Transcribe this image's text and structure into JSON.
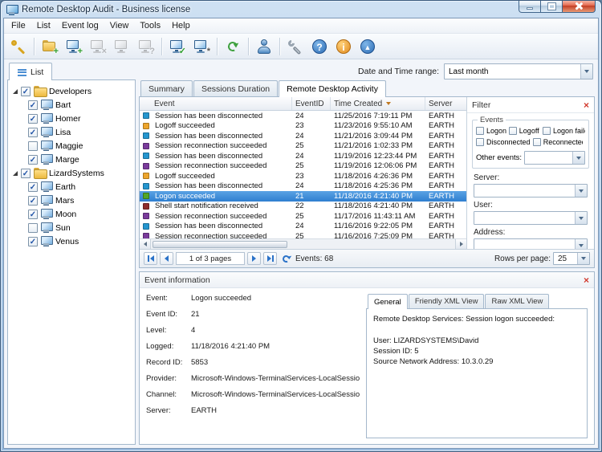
{
  "window": {
    "title": "Remote Desktop Audit - Business license"
  },
  "icons": {
    "check": "✓",
    "close": "×"
  },
  "colors": {
    "selection_blue": "#2f7fd0",
    "close_red": "#d23b2f",
    "accent_blue": "#2a72c8"
  },
  "menubar": {
    "items": [
      "File",
      "List",
      "Event log",
      "View",
      "Tools",
      "Help"
    ]
  },
  "toolbar": {
    "items": [
      {
        "icon": "key",
        "name": "license-key-button"
      },
      {
        "sep": true
      },
      {
        "icon": "folder-plus",
        "name": "add-group-button"
      },
      {
        "icon": "pc-plus",
        "name": "add-computer-button"
      },
      {
        "icon": "pc-delete",
        "name": "delete-computer-button",
        "disabled": true
      },
      {
        "icon": "pc-props",
        "name": "computer-properties-button",
        "disabled": true
      },
      {
        "icon": "pc-scan",
        "name": "scan-network-button",
        "disabled": true
      },
      {
        "sep": true
      },
      {
        "icon": "pc-check",
        "name": "collect-data-button"
      },
      {
        "icon": "pc-gear",
        "name": "collection-settings-button"
      },
      {
        "sep": true
      },
      {
        "icon": "refresh",
        "name": "refresh-button"
      },
      {
        "sep": true
      },
      {
        "icon": "user",
        "name": "user-sessions-button"
      },
      {
        "sep": true
      },
      {
        "icon": "wrench",
        "name": "options-button"
      },
      {
        "icon": "help",
        "name": "help-button"
      },
      {
        "icon": "about",
        "name": "about-button"
      },
      {
        "icon": "update",
        "name": "check-updates-button"
      }
    ]
  },
  "sidebar": {
    "tab_label": "List",
    "tree": [
      {
        "label": "Developers",
        "checked": true,
        "expanded": true,
        "children": [
          {
            "label": "Bart",
            "checked": true
          },
          {
            "label": "Homer",
            "checked": true
          },
          {
            "label": "Lisa",
            "checked": true
          },
          {
            "label": "Maggie",
            "checked": false
          },
          {
            "label": "Marge",
            "checked": true
          }
        ]
      },
      {
        "label": "LizardSystems",
        "checked": true,
        "expanded": true,
        "children": [
          {
            "label": "Earth",
            "checked": true
          },
          {
            "label": "Mars",
            "checked": true
          },
          {
            "label": "Moon",
            "checked": true
          },
          {
            "label": "Sun",
            "checked": false
          },
          {
            "label": "Venus",
            "checked": true
          }
        ]
      }
    ]
  },
  "main": {
    "date_range": {
      "label": "Date and Time range:",
      "value": "Last month"
    },
    "tabs": [
      {
        "label": "Summary"
      },
      {
        "label": "Sessions Duration"
      },
      {
        "label": "Remote Desktop Activity",
        "active": true
      }
    ]
  },
  "activity": {
    "columns": [
      {
        "label": "Event"
      },
      {
        "label": "EventID"
      },
      {
        "label": "Time Created",
        "sort": "desc"
      },
      {
        "label": "Server"
      }
    ],
    "type_colors": {
      "disconnected": "#2596cf",
      "logoff": "#eda52c",
      "reconnected": "#7a3b9b",
      "logon": "#53a626",
      "shell": "#8e2c2c"
    },
    "rows": [
      {
        "type": "disconnected",
        "event": "Session has been disconnected",
        "id": "24",
        "time": "11/25/2016 7:19:11 PM",
        "server": "EARTH"
      },
      {
        "type": "logoff",
        "event": "Logoff succeeded",
        "id": "23",
        "time": "11/23/2016 9:55:10 AM",
        "server": "EARTH"
      },
      {
        "type": "disconnected",
        "event": "Session has been disconnected",
        "id": "24",
        "time": "11/21/2016 3:09:44 PM",
        "server": "EARTH"
      },
      {
        "type": "reconnected",
        "event": "Session reconnection succeeded",
        "id": "25",
        "time": "11/21/2016 1:02:33 PM",
        "server": "EARTH"
      },
      {
        "type": "disconnected",
        "event": "Session has been disconnected",
        "id": "24",
        "time": "11/19/2016 12:23:44 PM",
        "server": "EARTH"
      },
      {
        "type": "reconnected",
        "event": "Session reconnection succeeded",
        "id": "25",
        "time": "11/19/2016 12:06:06 PM",
        "server": "EARTH"
      },
      {
        "type": "logoff",
        "event": "Logoff succeeded",
        "id": "23",
        "time": "11/18/2016 4:26:36 PM",
        "server": "EARTH"
      },
      {
        "type": "disconnected",
        "event": "Session has been disconnected",
        "id": "24",
        "time": "11/18/2016 4:25:36 PM",
        "server": "EARTH"
      },
      {
        "type": "logon",
        "event": "Logon succeeded",
        "id": "21",
        "time": "11/18/2016 4:21:40 PM",
        "server": "EARTH",
        "selected": true
      },
      {
        "type": "shell",
        "event": "Shell start notification received",
        "id": "22",
        "time": "11/18/2016 4:21:40 PM",
        "server": "EARTH"
      },
      {
        "type": "reconnected",
        "event": "Session reconnection succeeded",
        "id": "25",
        "time": "11/17/2016 11:43:11 AM",
        "server": "EARTH"
      },
      {
        "type": "disconnected",
        "event": "Session has been disconnected",
        "id": "24",
        "time": "11/16/2016 9:22:05 PM",
        "server": "EARTH"
      },
      {
        "type": "reconnected",
        "event": "Session reconnection succeeded",
        "id": "25",
        "time": "11/16/2016 7:25:09 PM",
        "server": "EARTH"
      }
    ],
    "pagination": {
      "page_text": "1 of 3 pages",
      "events_label": "Events: 68",
      "rows_per_page_label": "Rows per page:",
      "rows_per_page": "25"
    }
  },
  "filter": {
    "title": "Filter",
    "events_legend": "Events",
    "checkboxes": [
      "Logon",
      "Logoff",
      "Logon failed",
      "Disconnected",
      "Reconnected"
    ],
    "other_events_label": "Other events:",
    "fields": [
      {
        "label": "Server:"
      },
      {
        "label": "User:"
      },
      {
        "label": "Address:"
      }
    ]
  },
  "event_info": {
    "title": "Event information",
    "fields": [
      {
        "label": "Event:",
        "value": "Logon succeeded"
      },
      {
        "label": "Event ID:",
        "value": "21"
      },
      {
        "label": "Level:",
        "value": "4"
      },
      {
        "label": "Logged:",
        "value": "11/18/2016 4:21:40 PM"
      },
      {
        "label": "Record ID:",
        "value": "5853"
      },
      {
        "label": "Provider:",
        "value": "Microsoft-Windows-TerminalServices-LocalSessionManager"
      },
      {
        "label": "Channel:",
        "value": "Microsoft-Windows-TerminalServices-LocalSessionManager/Operationa"
      },
      {
        "label": "Server:",
        "value": "EARTH"
      }
    ],
    "tabs": [
      {
        "label": "General",
        "active": true
      },
      {
        "label": "Friendly XML View"
      },
      {
        "label": "Raw XML View"
      }
    ],
    "general_lines": [
      "Remote Desktop Services: Session logon succeeded:",
      "",
      "User: LIZARDSYSTEMS\\David",
      "Session ID: 5",
      "Source Network Address: 10.3.0.29"
    ]
  }
}
